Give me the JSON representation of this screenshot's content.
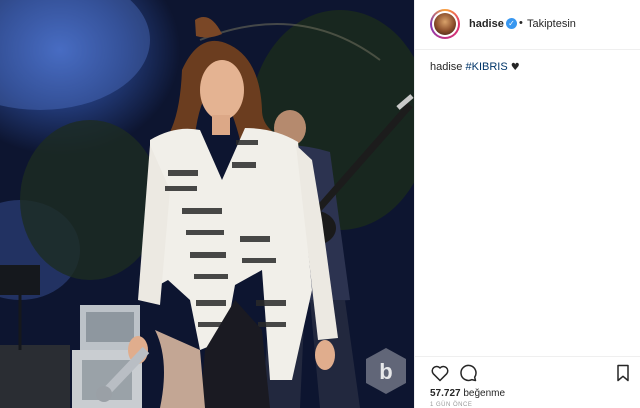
{
  "post": {
    "username": "hadise",
    "verified_mark": "✓",
    "separator": "•",
    "follow_status": "Takiptesin",
    "caption": {
      "user": "hadise",
      "hashtag": "#KIBRIS",
      "emoji": "♥"
    },
    "likes_count": "57.727",
    "likes_label": "beğenme",
    "timestamp": "1 GÜN ÖNCE"
  },
  "colors": {
    "accent_blue": "#3897f0",
    "hashtag": "#003569",
    "text": "#262626",
    "muted": "#999999"
  },
  "icons": [
    "heart-icon",
    "comment-icon",
    "share-icon",
    "bookmark-icon",
    "watermark-logo-icon"
  ]
}
